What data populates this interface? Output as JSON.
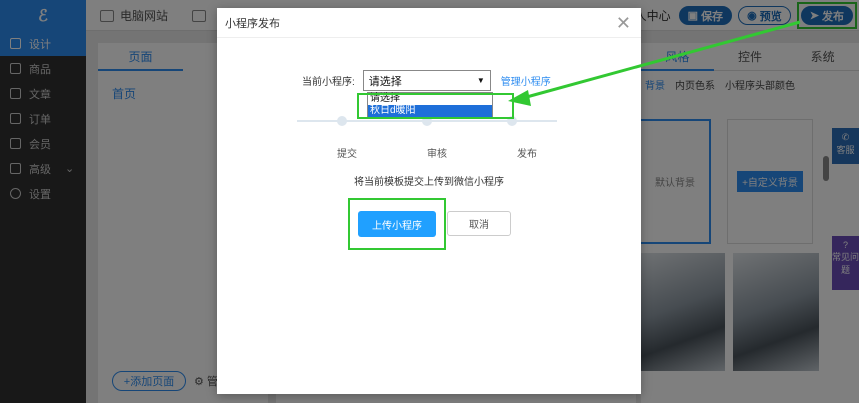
{
  "topbar": {
    "logo": "ℰ",
    "nav": [
      "电脑网站",
      ""
    ],
    "user_center": "个人中心",
    "save": "保存",
    "preview": "预览",
    "publish": "发布"
  },
  "sidebar": {
    "items": [
      {
        "label": "设计",
        "icon": "brush-icon",
        "active": true
      },
      {
        "label": "商品",
        "icon": "box-icon"
      },
      {
        "label": "文章",
        "icon": "doc-icon"
      },
      {
        "label": "订单",
        "icon": "order-icon"
      },
      {
        "label": "会员",
        "icon": "user-icon"
      },
      {
        "label": "高级",
        "icon": "grid-icon"
      },
      {
        "label": "设置",
        "icon": "gear-icon"
      }
    ]
  },
  "left_panel": {
    "tab": "页面",
    "home": "首页",
    "add_page": "+添加页面",
    "manage": "管"
  },
  "right_panel": {
    "tabs": [
      "风格",
      "控件",
      "系统"
    ],
    "subtabs": [
      "背景",
      "内页色系",
      "小程序头部颜色"
    ],
    "default_bg": "默认背景",
    "custom_bg": "+自定义背景"
  },
  "floating": {
    "service": "客服",
    "faq": "常见问题"
  },
  "modal": {
    "title": "小程序发布",
    "current_label": "当前小程序:",
    "select_value": "请选择",
    "manage_link": "管理小程序",
    "options": [
      "请选择",
      "秋日d暖阳"
    ],
    "steps": [
      "提交",
      "审核",
      "发布"
    ],
    "description": "将当前模板提交上传到微信小程序",
    "upload_button": "上传小程序",
    "cancel_button": "取消"
  },
  "colors": {
    "primary": "#2d8cf0",
    "highlight": "#32c832",
    "sidebar_bg": "#303030"
  }
}
